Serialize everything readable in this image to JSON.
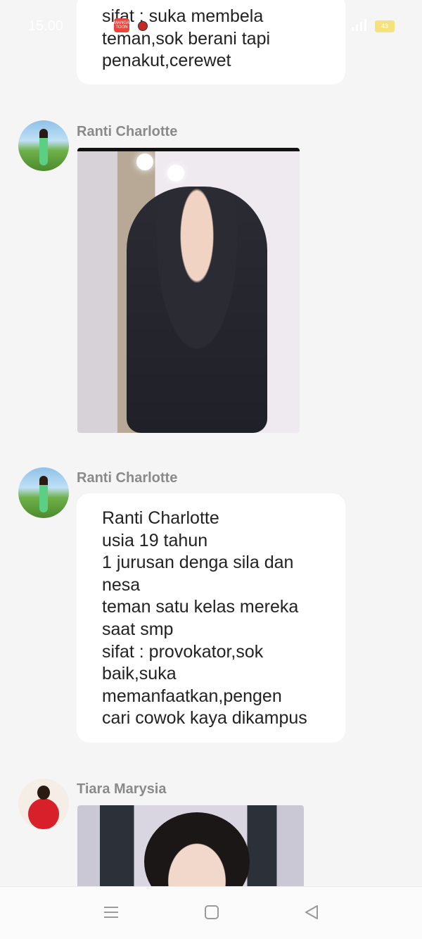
{
  "status_bar": {
    "time": "15.00",
    "app_badge": "MANGA TOON",
    "battery": "43"
  },
  "messages": [
    {
      "lines": [
        "sifat : suka membela",
        "teman,sok berani tapi",
        "penakut,cerewet"
      ]
    },
    {
      "sender": "Ranti Charlotte"
    },
    {
      "sender": "Ranti Charlotte",
      "lines": [
        "Ranti Charlotte",
        "usia 19 tahun",
        "1 jurusan denga sila dan",
        "nesa",
        "teman satu kelas mereka",
        "saat smp",
        "sifat : provokator,sok",
        "baik,suka",
        "memanfaatkan,pengen",
        "cari cowok kaya dikampus"
      ]
    },
    {
      "sender": "Tiara Marysia"
    }
  ],
  "icons": {
    "menu": "menu-icon",
    "home": "home-icon",
    "back": "back-icon"
  }
}
